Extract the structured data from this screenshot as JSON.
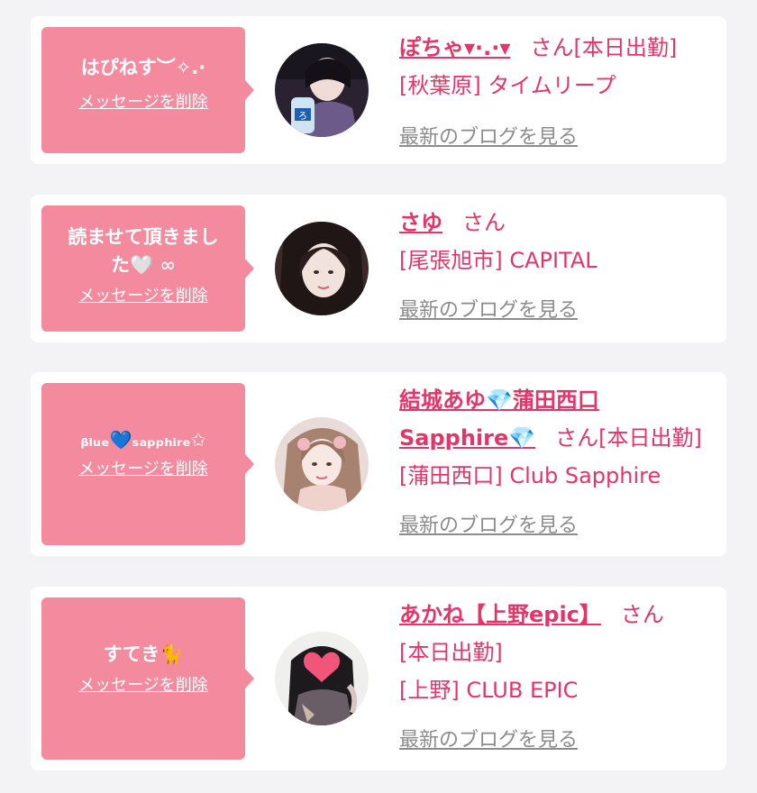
{
  "cards": [
    {
      "message": "はぴねす︶✧.·",
      "delete_label": "メッセージを削除",
      "name": "ぽちゃ▾·.·▾",
      "honorific": "さん",
      "status": "[本日出勤]",
      "location": "[秋葉原] タイムリープ",
      "blog_label": "最新のブログを見る"
    },
    {
      "message_line1": "読ませて頂きまし",
      "message_line2": "た",
      "message_emoji": "🤍 ∞",
      "delete_label": "メッセージを削除",
      "name": "さゆ",
      "honorific": "さん",
      "location": "[尾張旭市] CAPITAL",
      "blog_label": "最新のブログを見る"
    },
    {
      "message_part1": "ᵦₗᵤₑ",
      "message_heart": "💙",
      "message_part2": "ₛₐₚₚₕᵢᵣₑ✩",
      "delete_label": "メッセージを削除",
      "name_line1": "結城あゆ💎蒲田西口",
      "name_line2": "Sapphire💎",
      "honorific": "さん",
      "status": "[本日出勤]",
      "location": "[蒲田西口] Club Sapphire",
      "blog_label": "最新のブログを見る"
    },
    {
      "message": "すてき🐈",
      "delete_label": "メッセージを削除",
      "name": "あかね【上野epic】",
      "honorific": "さん",
      "status": "[本日出勤]",
      "location": "[上野] CLUB EPIC",
      "blog_label": "最新のブログを見る"
    }
  ],
  "colors": {
    "accent": "#e63468",
    "bubble": "#f48a9e",
    "link_gray": "#8c8c8c",
    "background": "#f3f3f5"
  },
  "icons": [
    "white-heart-icon",
    "blue-heart-icon",
    "gem-icon",
    "cat-icon",
    "heart-sticker-icon"
  ]
}
